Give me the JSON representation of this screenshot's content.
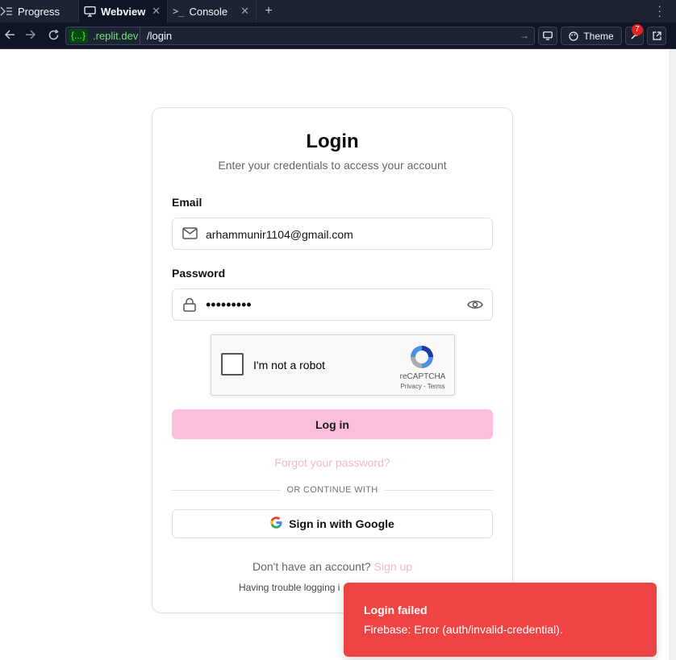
{
  "tabs": {
    "progress": "Progress",
    "webview": "Webview",
    "console": "Console"
  },
  "address": {
    "domain_chip": "{...}",
    "domain": ".replit.dev",
    "path": "/login",
    "theme_label": "Theme",
    "notification_count": "7"
  },
  "login": {
    "title": "Login",
    "subtitle": "Enter your credentials to access your account",
    "email_label": "Email",
    "email_value": "arhammunir1104@gmail.com",
    "password_label": "Password",
    "password_masked": "•••••••••",
    "recaptcha_text": "I'm not a robot",
    "recaptcha_brand": "reCAPTCHA",
    "recaptcha_links": "Privacy - Terms",
    "login_button": "Log in",
    "forgot_link": "Forgot your password?",
    "divider_text": "OR CONTINUE WITH",
    "google_button": "Sign in with Google",
    "no_account_text": "Don't have an account?",
    "signup_link": "Sign up",
    "trouble_text": "Having trouble logging i"
  },
  "toast": {
    "title": "Login failed",
    "message": "Firebase: Error (auth/invalid-credential)."
  },
  "colors": {
    "toast_bg": "#ef4444",
    "login_button_bg": "#fbbedd",
    "link_pink": "#f7b5d4",
    "topbar_bg": "#1c2333"
  }
}
